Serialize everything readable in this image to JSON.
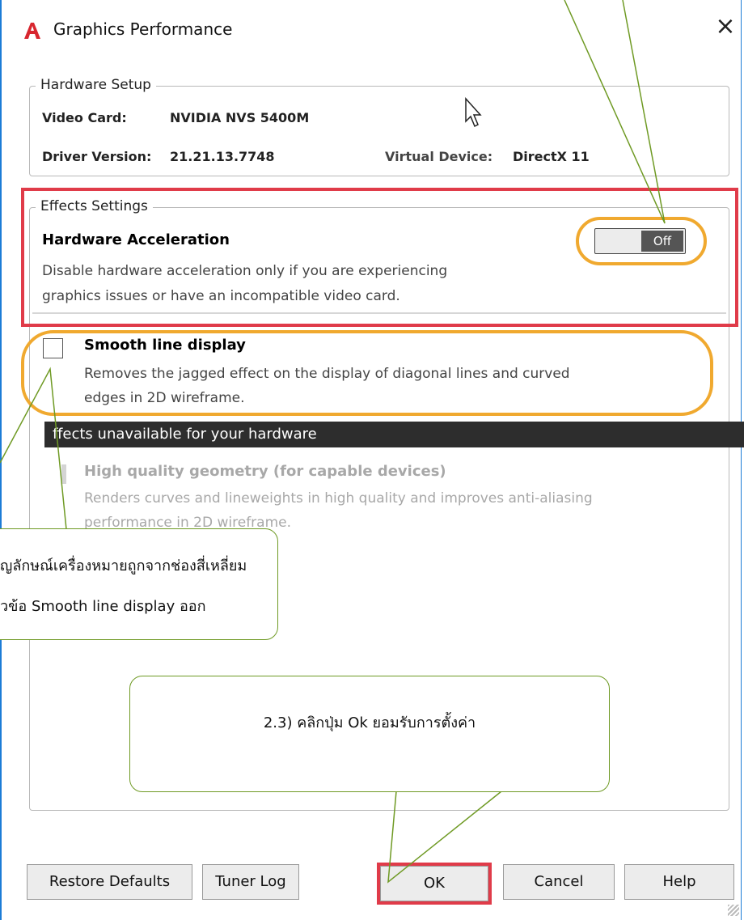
{
  "dialog": {
    "title": "Graphics Performance",
    "close_glyph": "×",
    "logo_icon": "autocad-a-icon",
    "colors": {
      "accent_border": "#1c7cd6",
      "logo_red": "#d8262f",
      "highlight_red": "#e03b49",
      "highlight_orange": "#f0a92f",
      "callout_green": "#6f9a24"
    }
  },
  "hardware": {
    "legend": "Hardware Setup",
    "video_card_label": "Video Card:",
    "video_card_value": "NVIDIA NVS 5400M",
    "driver_label": "Driver Version:",
    "driver_value": "21.21.13.7748",
    "virtual_label": "Virtual Device:",
    "virtual_value": "DirectX 11"
  },
  "effects": {
    "legend": "Effects Settings",
    "hw_accel_title": "Hardware Acceleration",
    "hw_accel_desc_1": "Disable hardware acceleration only if you are experiencing",
    "hw_accel_desc_2": "graphics issues or have an incompatible video card.",
    "toggle_state": "Off",
    "smooth_title": "Smooth line display",
    "smooth_desc_1": "Removes the jagged effect on the display of diagonal lines and curved",
    "smooth_desc_2": "edges in 2D wireframe.",
    "smooth_checked": false
  },
  "unavailable": {
    "header": "ffects unavailable for your hardware",
    "hq_title": "High quality geometry (for capable devices)",
    "hq_desc_1": "Renders curves and lineweights in high quality and improves anti-aliasing",
    "hq_desc_2": "performance in 2D wireframe."
  },
  "buttons": {
    "restore": "Restore Defaults",
    "tuner": "Tuner Log",
    "ok": "OK",
    "cancel": "Cancel",
    "help": "Help"
  },
  "callouts": {
    "left_line1": "ัญลักษณ์เครื่องหมายถูกจากช่องสี่เหลี่ยม",
    "left_line2": "วข้อ Smooth line display ออก",
    "ok_note": "2.3) คลิกปุ่ม Ok ยอมรับการตั้งค่า"
  }
}
